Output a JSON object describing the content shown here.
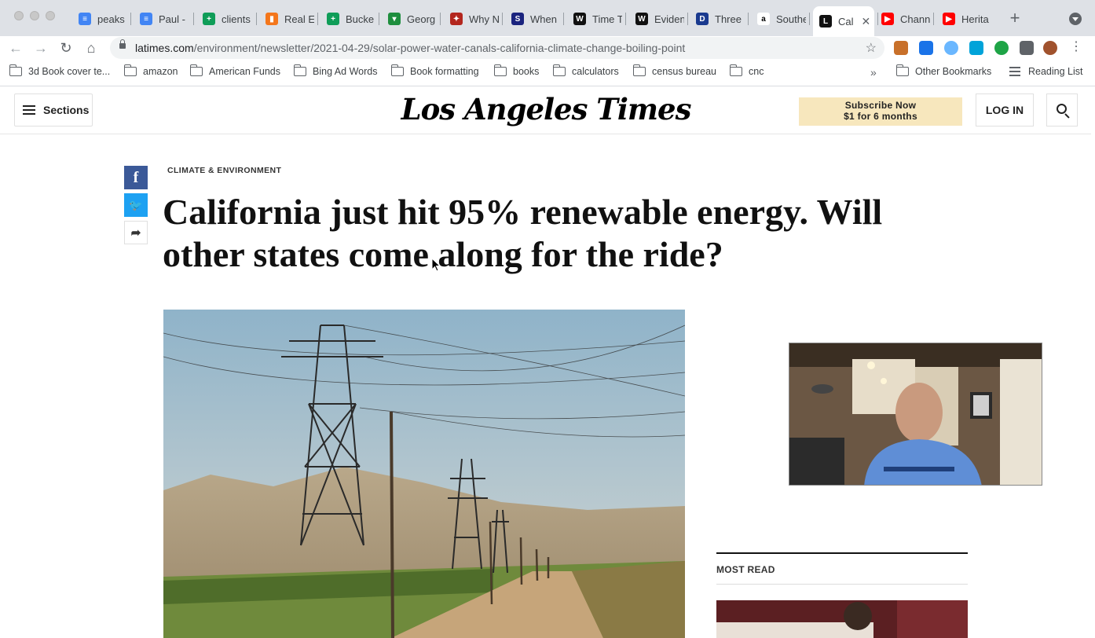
{
  "browser": {
    "tabs": [
      {
        "label": "peaks",
        "icon": "google-docs-icon",
        "color": "#4285f4",
        "glyph": "≡"
      },
      {
        "label": "Paul -",
        "icon": "google-docs-icon",
        "color": "#4285f4",
        "glyph": "≡"
      },
      {
        "label": "clients",
        "icon": "google-sheets-icon",
        "color": "#0f9d58",
        "glyph": "+"
      },
      {
        "label": "Real E",
        "icon": "chart-icon",
        "color": "#f4761b",
        "glyph": "▮"
      },
      {
        "label": "Bucke",
        "icon": "google-sheets-icon",
        "color": "#0f9d58",
        "glyph": "+"
      },
      {
        "label": "Georg",
        "icon": "wealth-icon",
        "color": "#1e8e3e",
        "glyph": "▾"
      },
      {
        "label": "Why N",
        "icon": "compass-icon",
        "color": "#b3261e",
        "glyph": "✦"
      },
      {
        "label": "When",
        "icon": "ssrn-icon",
        "color": "#1a237e",
        "glyph": "S"
      },
      {
        "label": "Time T",
        "icon": "wuwt-icon",
        "color": "#111111",
        "glyph": "W"
      },
      {
        "label": "Eviden",
        "icon": "wuwt-icon",
        "color": "#111111",
        "glyph": "W"
      },
      {
        "label": "Three",
        "icon": "di-icon",
        "color": "#1a3a8f",
        "glyph": "D"
      },
      {
        "label": "Southe",
        "icon": "amazon-icon",
        "color": "#ffffff",
        "glyph": "a"
      },
      {
        "label": "Cal",
        "icon": "latimes-icon",
        "color": "#111111",
        "glyph": "L",
        "active": true
      },
      {
        "label": "Chann",
        "icon": "youtube-icon",
        "color": "#ff0000",
        "glyph": "▶"
      },
      {
        "label": "Herita",
        "icon": "youtube-icon",
        "color": "#ff0000",
        "glyph": "▶"
      }
    ],
    "url_host": "latimes.com",
    "url_path": "/environment/newsletter/2021-04-29/solar-power-water-canals-california-climate-change-boiling-point",
    "bookmarks": [
      "3d Book cover te...",
      "amazon",
      "American Funds",
      "Bing Ad Words",
      "Book formatting",
      "books",
      "calculators",
      "census bureau",
      "cnc"
    ],
    "other_bookmarks": "Other Bookmarks",
    "reading_list": "Reading List",
    "extensions": [
      {
        "icon": "extension-orange-icon",
        "color": "#c8702a"
      },
      {
        "icon": "extension-calendar-icon",
        "color": "#1a73e8"
      },
      {
        "icon": "extension-circle-icon",
        "color": "#6ab7ff"
      },
      {
        "icon": "extension-cloud-icon",
        "color": "#00a3d9"
      },
      {
        "icon": "extension-green-icon",
        "color": "#1ea446"
      },
      {
        "icon": "puzzle-icon",
        "color": "#5f6368"
      },
      {
        "icon": "profile-avatar-icon",
        "color": "#a0522d"
      }
    ]
  },
  "site": {
    "sections_label": "Sections",
    "logo": "Los Angeles Times",
    "subscribe_line1": "Subscribe Now",
    "subscribe_line2": "$1 for 6 months",
    "login_label": "LOG IN"
  },
  "article": {
    "kicker": "CLIMATE & ENVIRONMENT",
    "headline": "California just hit 95% renewable energy. Will other states come along for the ride?",
    "share": {
      "facebook": "f",
      "twitter": "🐦",
      "forward": "➦"
    }
  },
  "sidebar": {
    "most_read_label": "MOST READ"
  },
  "colors": {
    "subscribe_bg": "#f7e7bd",
    "facebook": "#3b5998",
    "twitter": "#1da1f2",
    "tabbar": "#dee1e6"
  }
}
